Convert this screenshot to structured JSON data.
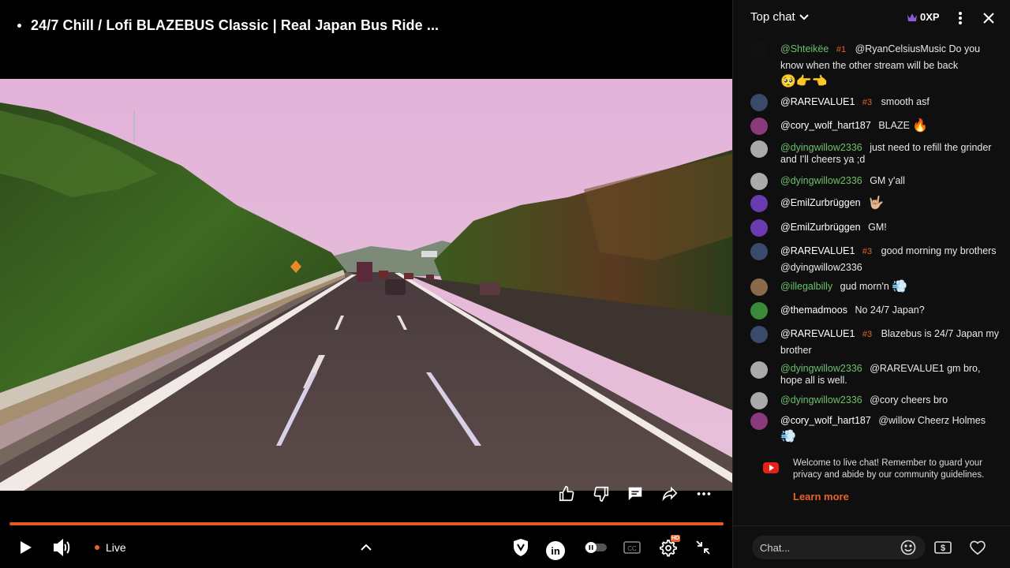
{
  "video": {
    "title": "24/7 Chill  / Lofi BLAZEBUS Classic | Real Japan Bus Ride ...",
    "live_label": "Live",
    "progress_fraction": 1.0
  },
  "colors": {
    "accent": "#e8622b",
    "progress": "#e45a25",
    "username_green": "#6cc06b",
    "chat_bg": "#0f0f0f"
  },
  "actions": {
    "icons": [
      "thumbs-up-icon",
      "thumbs-down-icon",
      "comment-icon",
      "share-icon",
      "more-horizontal-icon"
    ]
  },
  "controls": {
    "icons": [
      "play-icon",
      "volume-icon",
      "chevron-up-icon",
      "shield-icon",
      "linkedin-icon",
      "autoplay-toggle",
      "captions-icon",
      "settings-icon",
      "exit-fullscreen-icon"
    ],
    "settings_badge": "HD"
  },
  "chat": {
    "header": {
      "mode_label": "Top chat",
      "xp": "0XP"
    },
    "messages": [
      {
        "author": "@Shteikëe",
        "rank": "#1",
        "text": "@RyanCelsiusMusic Do you know when the other stream will be back",
        "emoji": "🥺👉👈",
        "green": true
      },
      {
        "author": "@RAREVALUE1",
        "rank": "#3",
        "text": "smooth asf",
        "emoji": "",
        "green": false
      },
      {
        "author": "@cory_wolf_hart187",
        "rank": "",
        "text": "BLAZE",
        "emoji": "🔥",
        "green": false
      },
      {
        "author": "@dyingwillow2336",
        "rank": "",
        "text": "just need to refill the grinder and I'll cheers ya ;d",
        "emoji": "",
        "green": true
      },
      {
        "author": "@dyingwillow2336",
        "rank": "",
        "text": "GM y'all",
        "emoji": "",
        "green": true
      },
      {
        "author": "@EmilZurbrüggen",
        "rank": "",
        "text": "",
        "emoji": "🤟🏼",
        "green": false
      },
      {
        "author": "@EmilZurbrüggen",
        "rank": "",
        "text": "GM!",
        "emoji": "",
        "green": false
      },
      {
        "author": "@RAREVALUE1",
        "rank": "#3",
        "text": "good morning my brothers @dyingwillow2336",
        "emoji": "",
        "green": false
      },
      {
        "author": "@illegalbilly",
        "rank": "",
        "text": "gud morn'n",
        "emoji": "💨",
        "green": true
      },
      {
        "author": "@themadmoos",
        "rank": "",
        "text": "No 24/7 Japan?",
        "emoji": "",
        "green": false
      },
      {
        "author": "@RAREVALUE1",
        "rank": "#3",
        "text": "Blazebus is 24/7 Japan my brother",
        "emoji": "",
        "green": false
      },
      {
        "author": "@dyingwillow2336",
        "rank": "",
        "text": "@RAREVALUE1 gm bro, hope all is well.",
        "emoji": "",
        "green": true
      },
      {
        "author": "@dyingwillow2336",
        "rank": "",
        "text": "@cory cheers bro",
        "emoji": "",
        "green": true
      },
      {
        "author": "@cory_wolf_hart187",
        "rank": "",
        "text": "@willow Cheerz Holmes",
        "emoji": "💨",
        "green": false
      }
    ],
    "welcome": {
      "text": "Welcome to live chat! Remember to guard your privacy and abide by our community guidelines.",
      "learn_more": "Learn more"
    },
    "input": {
      "placeholder": "Chat..."
    }
  }
}
